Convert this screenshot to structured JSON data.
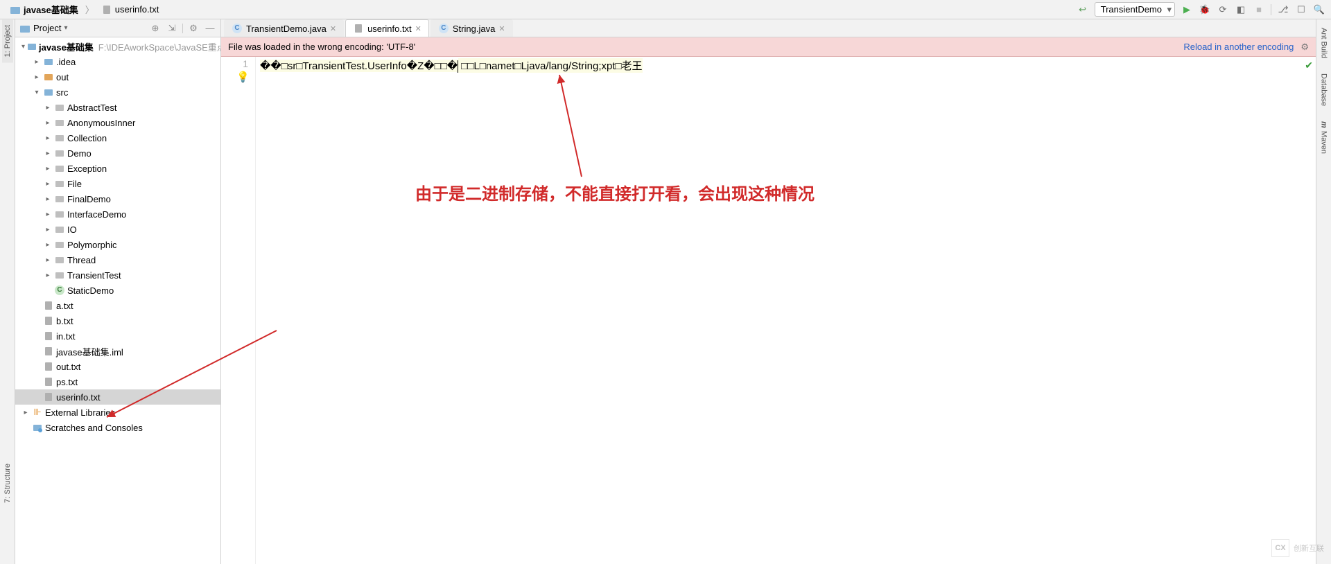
{
  "breadcrumbs": {
    "project": "javase基础集",
    "file": "userinfo.txt"
  },
  "run": {
    "config": "TransientDemo"
  },
  "project_panel": {
    "title": "Project",
    "root": {
      "name": "javase基础集",
      "path": "F:\\IDEAworkSpace\\JavaSE重点"
    },
    "idea": ".idea",
    "out": "out",
    "src": "src",
    "src_dirs": [
      "AbstractTest",
      "AnonymousInner",
      "Collection",
      "Demo",
      "Exception",
      "File",
      "FinalDemo",
      "InterfaceDemo",
      "IO",
      "Polymorphic",
      "Thread",
      "TransientTest"
    ],
    "static_demo": "StaticDemo",
    "files": [
      "a.txt",
      "b.txt",
      "in.txt",
      "javase基础集.iml",
      "out.txt",
      "ps.txt",
      "userinfo.txt"
    ],
    "ext_lib": "External Libraries",
    "scratches": "Scratches and Consoles"
  },
  "tabs": [
    {
      "label": "TransientDemo.java",
      "type": "java"
    },
    {
      "label": "userinfo.txt",
      "type": "txt",
      "active": true
    },
    {
      "label": "String.java",
      "type": "java"
    }
  ],
  "banner": {
    "message": "File was loaded in the wrong encoding: 'UTF-8'",
    "link": "Reload in another encoding"
  },
  "editor": {
    "line_no": "1",
    "content_a": "��□sr□TransientTest.UserInfo�Z�□□�",
    "content_b": " □□L□namet□Ljava/lang/String;xpt□老王"
  },
  "annotation": "由于是二进制存储，不能直接打开看，会出现这种情况",
  "right_tabs": {
    "ant": "Ant Build",
    "db": "Database",
    "maven": "Maven"
  },
  "left_tabs": {
    "project": "1: Project",
    "structure": "7: Structure"
  },
  "watermark": "创新互联"
}
